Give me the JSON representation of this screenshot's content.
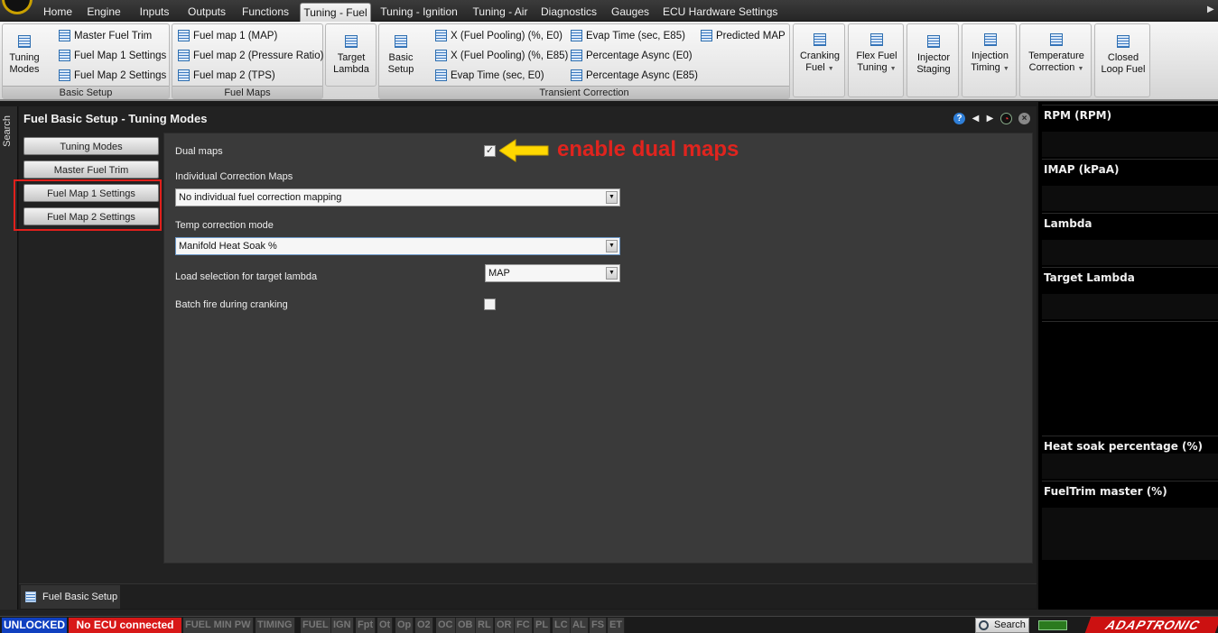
{
  "menu": {
    "tabs": [
      "Home",
      "Engine",
      "Inputs",
      "Outputs",
      "Functions",
      "Tuning - Fuel",
      "Tuning - Ignition",
      "Tuning - Air",
      "Diagnostics",
      "Gauges",
      "ECU Hardware Settings"
    ],
    "active_tab": "Tuning - Fuel"
  },
  "ribbon": {
    "basic_setup": {
      "label": "Basic Setup",
      "tuning_modes": "Tuning Modes",
      "items": [
        "Master Fuel Trim",
        "Fuel Map 1 Settings",
        "Fuel Map 2 Settings"
      ]
    },
    "fuel_maps": {
      "label": "Fuel Maps",
      "items": [
        "Fuel map 1 (MAP)",
        "Fuel map 2 (Pressure Ratio)",
        "Fuel map 2 (TPS)"
      ]
    },
    "target_lambda": "Target Lambda",
    "transient": {
      "label": "Transient Correction",
      "basic_setup": "Basic Setup",
      "col1": [
        "X (Fuel Pooling) (%, E0)",
        "X (Fuel Pooling) (%, E85)",
        "Evap Time (sec, E0)"
      ],
      "col2": [
        "Evap Time (sec, E85)",
        "Percentage Async (E0)",
        "Percentage Async (E85)"
      ],
      "col3": [
        "Predicted MAP"
      ]
    },
    "cranking_fuel": "Cranking Fuel",
    "flex_fuel": "Flex Fuel Tuning",
    "injector_staging": "Injector Staging",
    "injection_timing": "Injection Timing",
    "temperature_correction": "Temperature Correction",
    "closed_loop": "Closed Loop Fuel"
  },
  "search_strip": "Search",
  "panel": {
    "title": "Fuel Basic Setup - Tuning Modes",
    "nav": [
      "Tuning Modes",
      "Master Fuel Trim",
      "Fuel Map 1 Settings",
      "Fuel Map 2 Settings"
    ],
    "dual_maps_label": "Dual maps",
    "dual_maps_checked": true,
    "annotation": "enable dual maps",
    "individual_label": "Individual Correction Maps",
    "individual_value": "No individual fuel correction mapping",
    "temp_label": "Temp correction mode",
    "temp_value": "Manifold Heat Soak %",
    "load_label": "Load selection for target lambda",
    "load_value": "MAP",
    "batch_label": "Batch fire during cranking",
    "batch_checked": false
  },
  "bottom_tab": "Fuel Basic Setup",
  "gauges": [
    "RPM (RPM)",
    "IMAP  (kPaA)",
    "Lambda",
    "Target Lambda",
    "Heat soak percentage (%)",
    "FuelTrim master (%)"
  ],
  "status": {
    "unlocked": "UNLOCKED",
    "ecu": "No ECU connected",
    "indicators": [
      "FUEL MIN PW",
      "TIMING",
      "FUEL",
      "IGN",
      "Fpt",
      "Ot",
      "Op",
      "O2",
      "OC",
      "OB",
      "RL",
      "OR",
      "FC",
      "PL",
      "LC",
      "AL",
      "FS",
      "ET"
    ],
    "search": "Search",
    "brand": "ADAPTRONIC"
  },
  "colors": {
    "annotation_red": "#e0241e",
    "arrow_yellow": "#ffd800",
    "unlocked_blue": "#1040c0",
    "ecu_red": "#d81818"
  }
}
